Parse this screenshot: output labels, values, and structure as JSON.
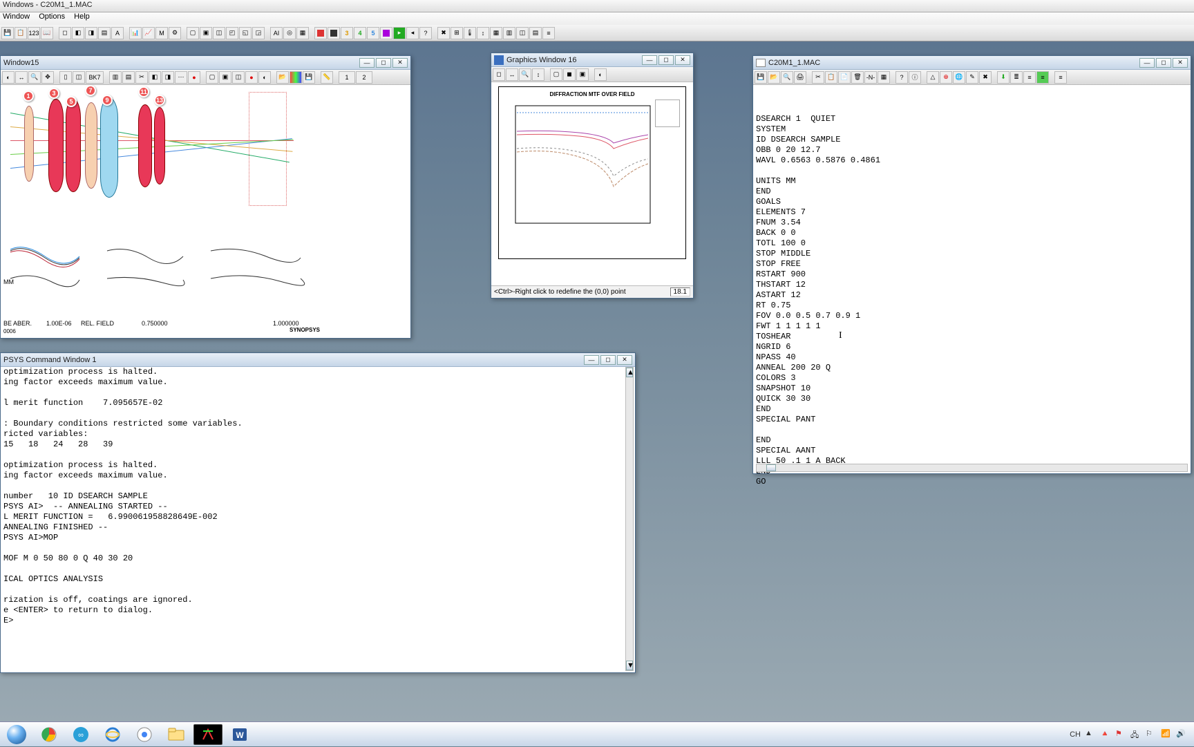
{
  "app": {
    "title": " Windows - C20M1_1.MAC"
  },
  "menu": {
    "window": "Window",
    "options": "Options",
    "help": "Help"
  },
  "win_graphics15": {
    "title": "Window15",
    "labels": {
      "beaber": "BE ABER.",
      "v1": "1.00E-06",
      "relfield": "REL. FIELD",
      "v2": "0.750000",
      "v3": "1.000000",
      "mm": "MM",
      "synopsys": "SYNOPSYS",
      "n006": "0006"
    },
    "bubbles": [
      "1",
      "3",
      "5",
      "7",
      "9",
      "11",
      "13"
    ]
  },
  "win_graphics16": {
    "title": "Graphics Window 16",
    "plot_title": "DIFFRACTION MTF OVER FIELD",
    "status": "<Ctrl>-Right click to redefine the (0,0) point",
    "coord": "18.1"
  },
  "win_editor": {
    "title": "C20M1_1.MAC",
    "lines": [
      "DSEARCH 1  QUIET",
      "SYSTEM",
      "ID DSEARCH SAMPLE",
      "OBB 0 20 12.7",
      "WAVL 0.6563 0.5876 0.4861",
      "",
      "UNITS MM",
      "END",
      "GOALS",
      "ELEMENTS 7",
      "FNUM 3.54",
      "BACK 0 0",
      "TOTL 100 0",
      "STOP MIDDLE",
      "STOP FREE",
      "RSTART 900",
      "THSTART 12",
      "ASTART 12",
      "RT 0.75",
      "FOV 0.0 0.5 0.7 0.9 1",
      "FWT 1 1 1 1 1",
      "TOSHEAR",
      "NGRID 6",
      "NPASS 40",
      "ANNEAL 200 20 Q",
      "COLORS 3",
      "SNAPSHOT 10",
      "QUICK 30 30",
      "END",
      "SPECIAL PANT",
      "",
      "END",
      "SPECIAL AANT",
      "LLL 50 .1 1 A BACK",
      "END",
      "GO"
    ]
  },
  "win_command": {
    "title": "PSYS Command Window 1",
    "lines": [
      "optimization process is halted.",
      "ing factor exceeds maximum value.",
      "",
      "l merit function    7.095657E-02",
      "",
      ": Boundary conditions restricted some variables.",
      "ricted variables:",
      "15   18   24   28   39",
      "",
      "optimization process is halted.",
      "ing factor exceeds maximum value.",
      "",
      "number   10 ID DSEARCH SAMPLE",
      "PSYS AI>  -- ANNEALING STARTED --",
      "L MERIT FUNCTION =   6.990061958828649E-002",
      "ANNEALING FINISHED --",
      "PSYS AI>MOP",
      "",
      "MOF M 0 50 80 0 Q 40 30 20",
      "",
      "ICAL OPTICS ANALYSIS",
      "",
      "rization is off, coatings are ignored.",
      "e <ENTER> to return to dialog.",
      "E>"
    ]
  },
  "tray": {
    "lang": "CH"
  }
}
